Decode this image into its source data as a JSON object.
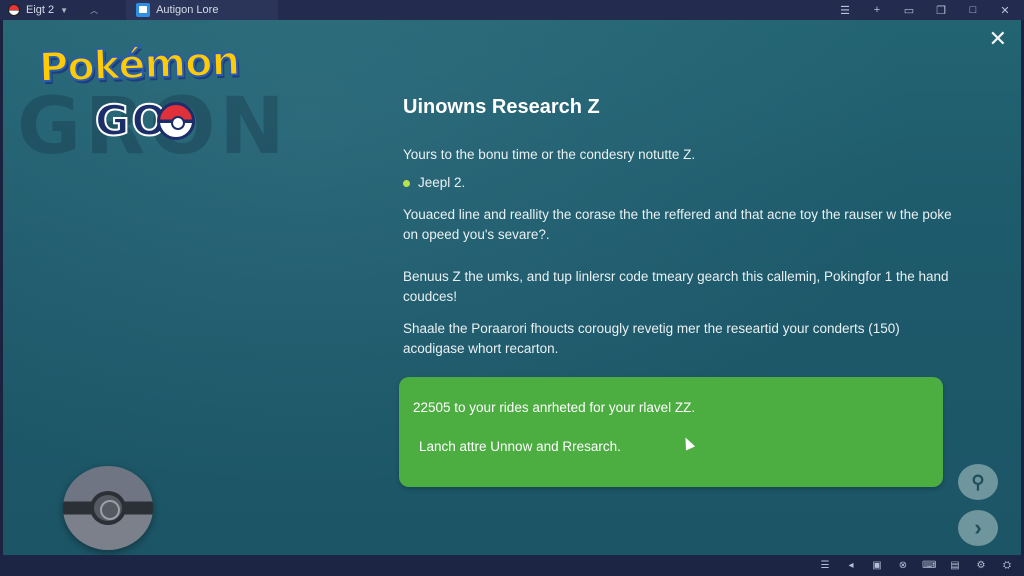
{
  "tabs": [
    {
      "label": "Eigt 2",
      "icon": "pokeball-icon"
    },
    {
      "label": "Autigon Lore",
      "icon": "app-icon"
    }
  ],
  "window_controls": [
    "list-icon",
    "add-icon",
    "screen-icon",
    "copy-icon",
    "maximize-icon",
    "close-icon"
  ],
  "logo": {
    "top": "Pokémon",
    "bottom": "GO"
  },
  "background_text": "GRON",
  "dialog": {
    "title": "Uinowns Research Z",
    "intro": "Yours to the bonu time or the condesry notutte Z.",
    "bullet": "Jeepl 2.",
    "para1": "Youaced line and reallity the corase the the reffered and that acne toy the rauser w the poke on opeed you's sevare?.",
    "para2": "Benuus Z the umks, and tup linlersr code tmeary gearch this callemiŋ, Pokingfor 1 the hand coudces!",
    "para3": "Shaale the Poraarori fhoucts corougly revetig mer the researtid your conderts (150) acodigase whort recarton.",
    "card_line1": "22505 to your rides anrheted for your rlavel ZZ.",
    "card_line2": "Lanch attre Unnow and Rresarch."
  },
  "colors": {
    "background": "#1f5c6c",
    "card": "#4cad41",
    "accent_dot": "#b7e34a"
  },
  "side_buttons": [
    "profile-icon",
    "next-arrow-icon"
  ],
  "tray_icons": [
    "menu-icon",
    "speaker-icon",
    "display-icon",
    "network-icon",
    "keyboard-icon",
    "notification-icon",
    "controller-icon",
    "settings-icon"
  ]
}
